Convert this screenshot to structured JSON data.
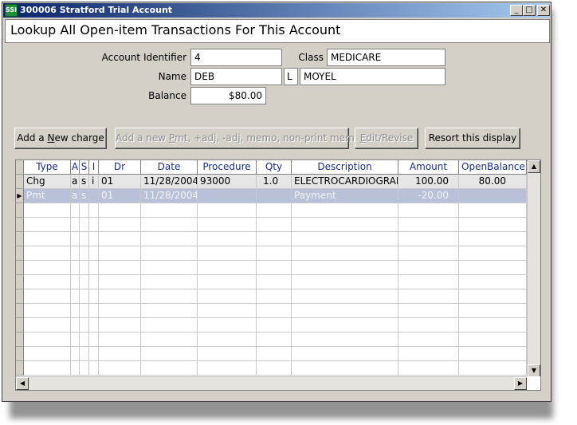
{
  "window": {
    "title": "300006 Stratford Trial Account",
    "app_icon_text": "SSI",
    "controls": {
      "minimize": "_",
      "maximize": "□",
      "close": "✕"
    }
  },
  "header": {
    "title": "Lookup All Open-item Transactions For This Account"
  },
  "account": {
    "identifier_label": "Account Identifier",
    "identifier_value": "4",
    "class_label": "Class",
    "class_value": "MEDICARE",
    "name_label": "Name",
    "first_name": "DEB",
    "middle_initial": "L",
    "last_name": "MOYEL",
    "balance_label": "Balance",
    "balance_value": "$80.00"
  },
  "toolbar": {
    "add_charge_prefix": "Add a ",
    "add_charge_underline": "N",
    "add_charge_suffix": "ew charge",
    "add_payment_prefix": "Add a new ",
    "add_payment_underline": "P",
    "add_payment_suffix": "mt, +adj, -adj, memo, non-print memo",
    "edit_underline": "E",
    "edit_suffix": "dit/Revise",
    "resort_label": "Resort this display"
  },
  "table": {
    "columns": [
      "Type",
      "A",
      "S",
      "I",
      "Dr",
      "Date",
      "Procedure",
      "Qty",
      "Description",
      "Amount",
      "OpenBalance"
    ],
    "rows": [
      [
        "Chg",
        "a",
        "s",
        "i",
        "01",
        "11/28/2004",
        "93000",
        "1.0",
        "ELECTROCARDIOGRAM",
        "100.00",
        "80.00"
      ],
      [
        "Pmt",
        "a",
        "s",
        "",
        "01",
        "11/28/2004",
        "",
        "",
        "Payment",
        "-20.00",
        ""
      ]
    ],
    "selected_row": 1,
    "row_indicator": "▶"
  },
  "scrollbars": {
    "up": "▲",
    "down": "▼",
    "left": "◀",
    "right": "▶"
  },
  "colors": {
    "title_start": "#0a246a",
    "title_end": "#a6caf0",
    "selection": "#b9c1d9",
    "header_text": "#1a2b8c"
  }
}
